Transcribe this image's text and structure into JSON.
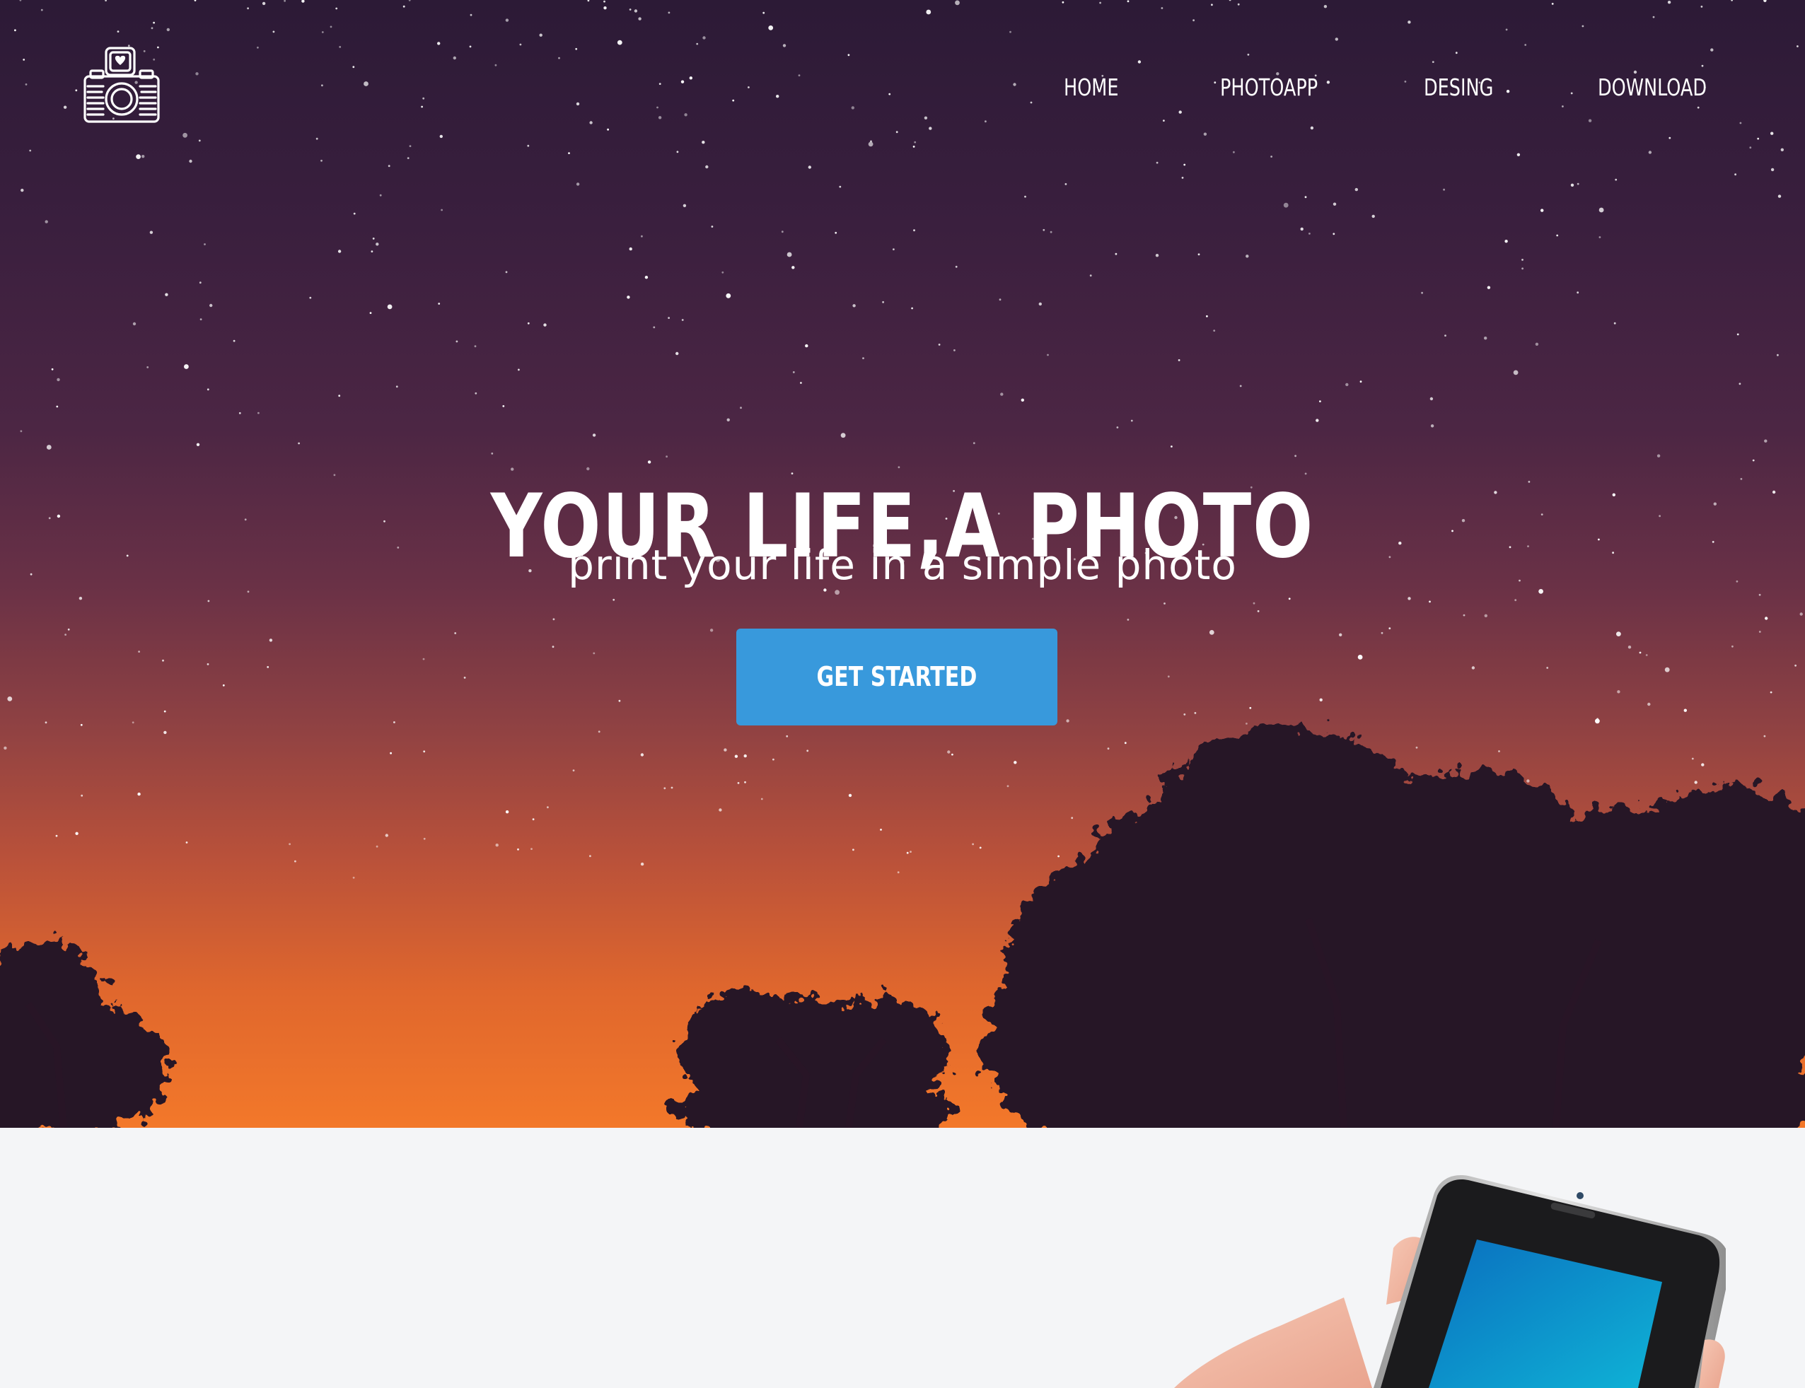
{
  "nav": {
    "items": [
      "HOME",
      "PHOTOAPP",
      "DESING",
      "DOWNLOAD"
    ]
  },
  "hero": {
    "title": "YOUR LIFE,A PHOTO",
    "subtitle": "print your life in a simple photo",
    "cta_label": "GET STARTED"
  },
  "icons": {
    "logo": "camera-heart-icon"
  },
  "colors": {
    "cta": "#3899dc",
    "sky_top": "#2c1a36",
    "sky_bottom": "#f3782a",
    "lower_bg": "#f4f5f7"
  }
}
